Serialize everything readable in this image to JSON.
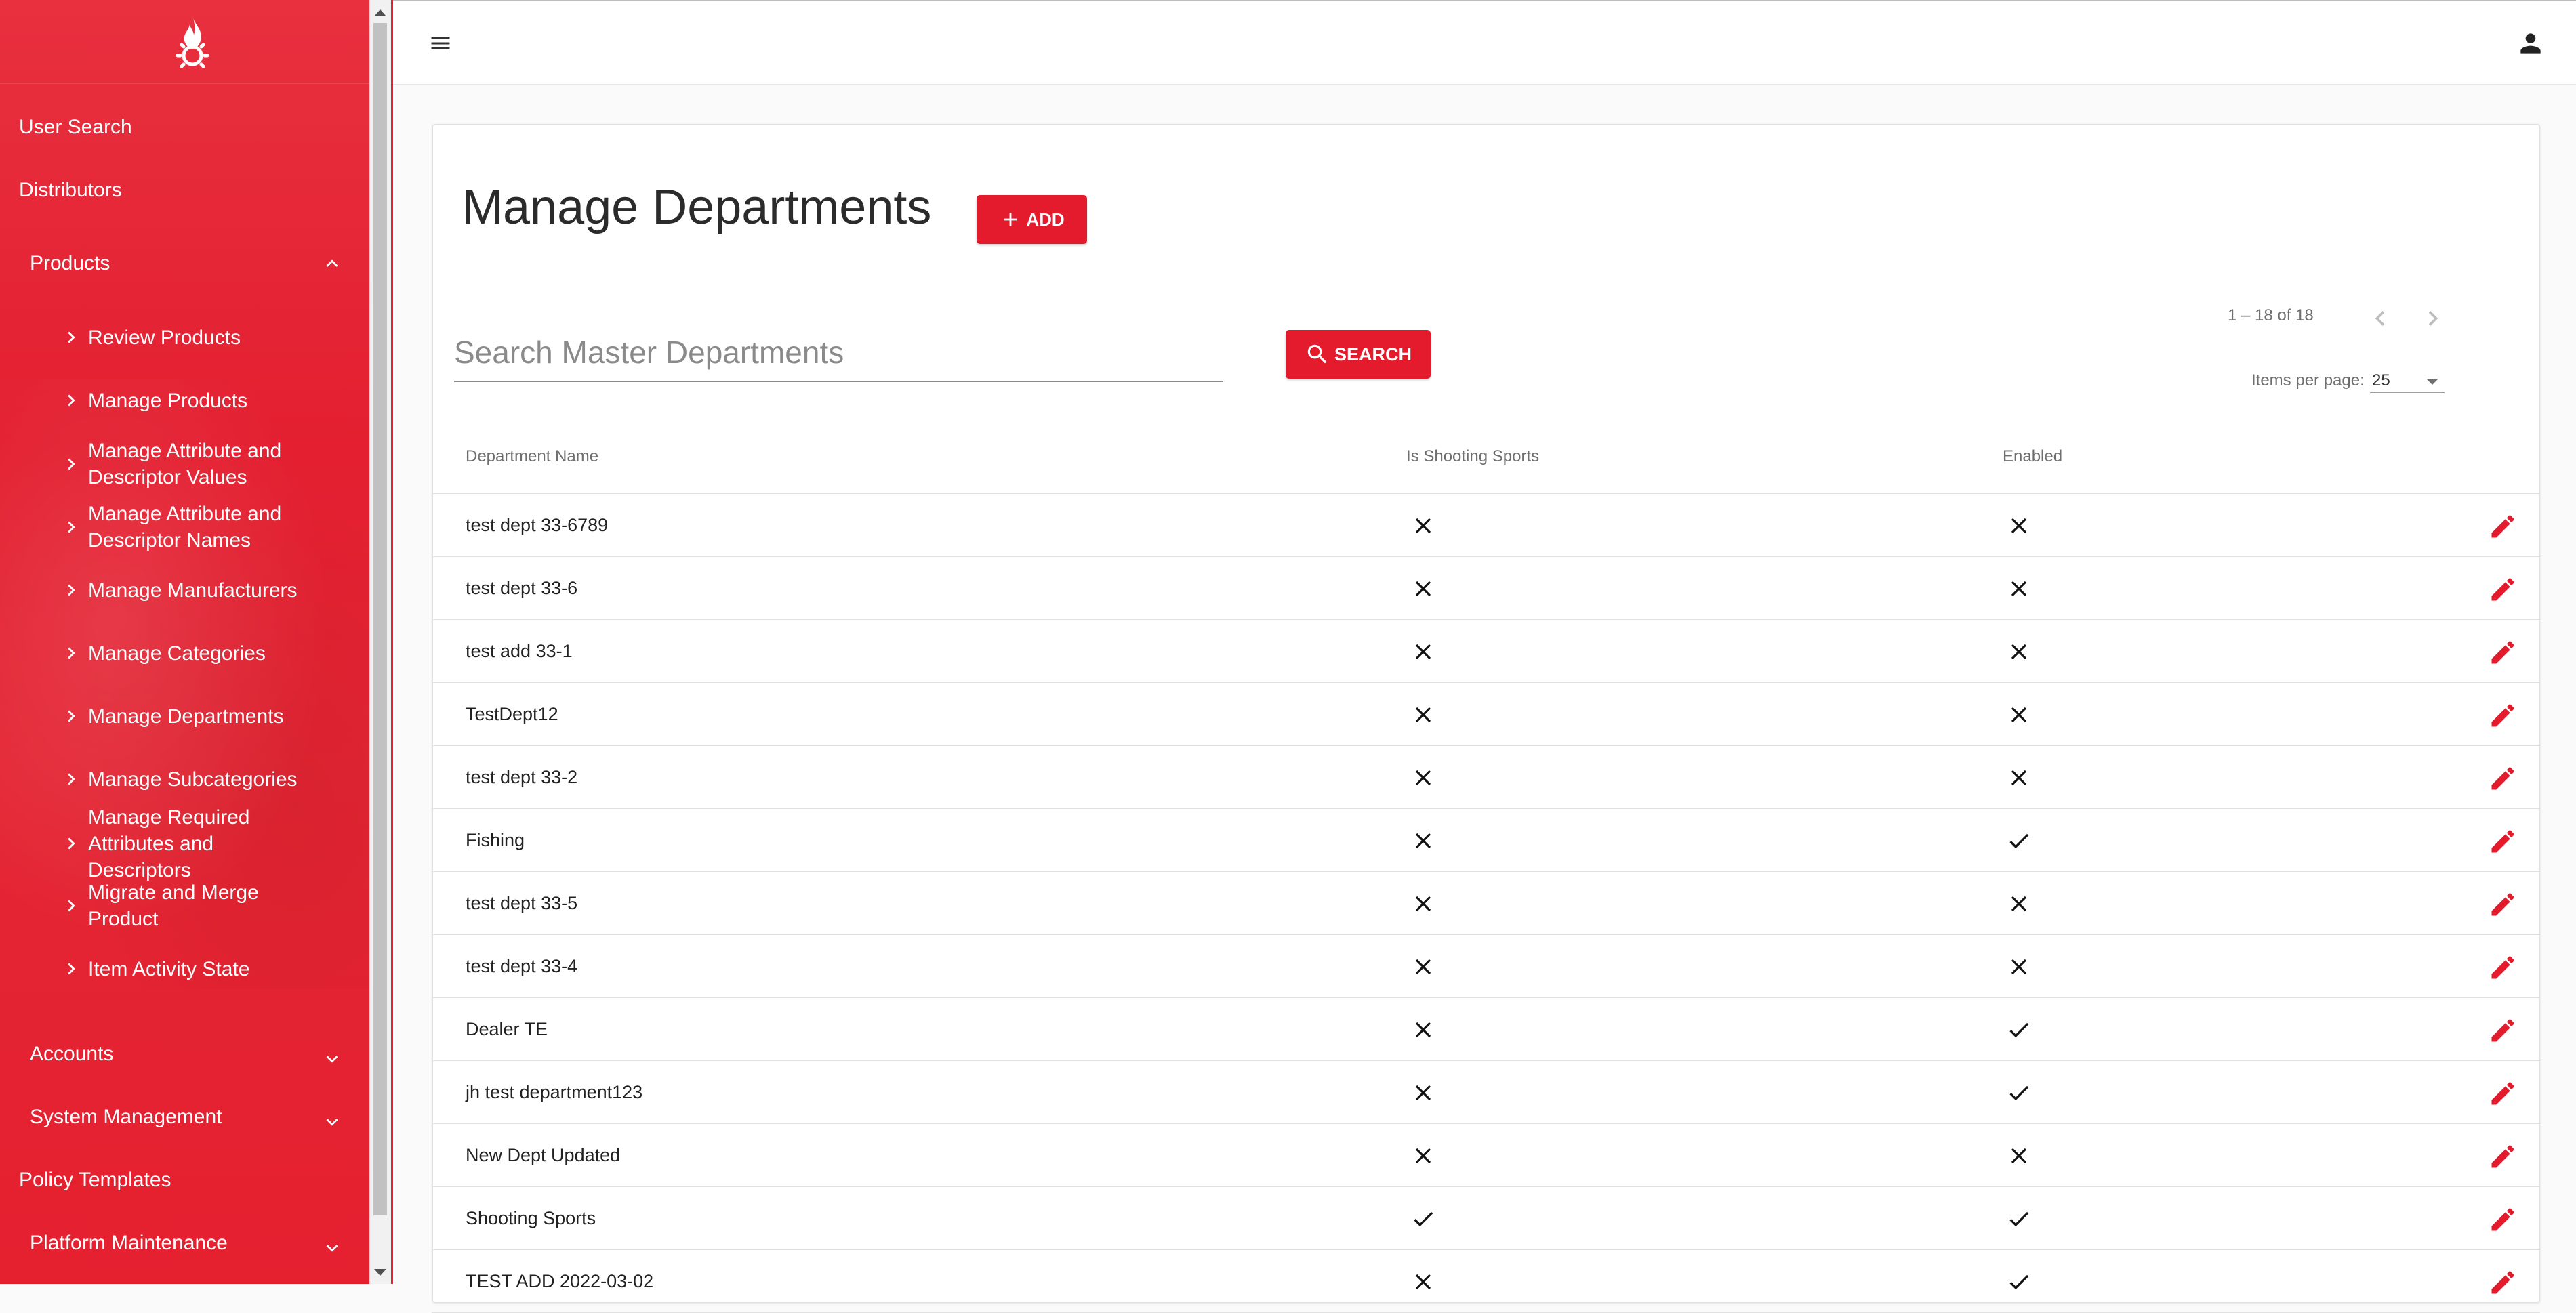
{
  "colors": {
    "brand": "#e31b2c",
    "sidebar": "#e42635"
  },
  "sidebar": {
    "logo": "flame-gear-logo",
    "items": [
      {
        "label": "User Search"
      },
      {
        "label": "Distributors"
      },
      {
        "label": "Products",
        "expanded": true
      },
      {
        "label": "Review Products"
      },
      {
        "label": "Manage Products"
      },
      {
        "label": "Manage Attribute and Descriptor Values"
      },
      {
        "label": "Manage Attribute and Descriptor Names"
      },
      {
        "label": "Manage Manufacturers"
      },
      {
        "label": "Manage Categories"
      },
      {
        "label": "Manage Departments"
      },
      {
        "label": "Manage Subcategories"
      },
      {
        "label": "Manage Required Attributes and Descriptors"
      },
      {
        "label": "Migrate and Merge Product"
      },
      {
        "label": "Item Activity State"
      },
      {
        "label": "Accounts",
        "expanded": false
      },
      {
        "label": "System Management",
        "expanded": false
      },
      {
        "label": "Policy Templates"
      },
      {
        "label": "Platform Maintenance",
        "expanded": false
      }
    ]
  },
  "topbar": {
    "menu_icon": "hamburger-menu-icon",
    "user_icon": "account-icon"
  },
  "main": {
    "title": "Manage Departments",
    "add_label": "ADD",
    "search": {
      "placeholder": "Search Master Departments",
      "value": "",
      "button_label": "SEARCH"
    },
    "paginator": {
      "range": "1 – 18 of 18",
      "items_per_page_label": "Items per page:",
      "items_per_page": "25"
    },
    "table": {
      "headers": [
        "Department Name",
        "Is Shooting Sports",
        "Enabled"
      ],
      "rows": [
        {
          "name": "test dept 33-6789",
          "shooting": false,
          "enabled": false
        },
        {
          "name": "test dept 33-6",
          "shooting": false,
          "enabled": false
        },
        {
          "name": "test add 33-1",
          "shooting": false,
          "enabled": false
        },
        {
          "name": "TestDept12",
          "shooting": false,
          "enabled": false
        },
        {
          "name": "test dept 33-2",
          "shooting": false,
          "enabled": false
        },
        {
          "name": "Fishing",
          "shooting": false,
          "enabled": true
        },
        {
          "name": "test dept 33-5",
          "shooting": false,
          "enabled": false
        },
        {
          "name": "test dept 33-4",
          "shooting": false,
          "enabled": false
        },
        {
          "name": "Dealer TE",
          "shooting": false,
          "enabled": true
        },
        {
          "name": "jh test department123",
          "shooting": false,
          "enabled": true
        },
        {
          "name": "New Dept Updated",
          "shooting": false,
          "enabled": false
        },
        {
          "name": "Shooting Sports",
          "shooting": true,
          "enabled": true
        },
        {
          "name": "TEST ADD 2022-03-02",
          "shooting": false,
          "enabled": true
        }
      ]
    }
  }
}
